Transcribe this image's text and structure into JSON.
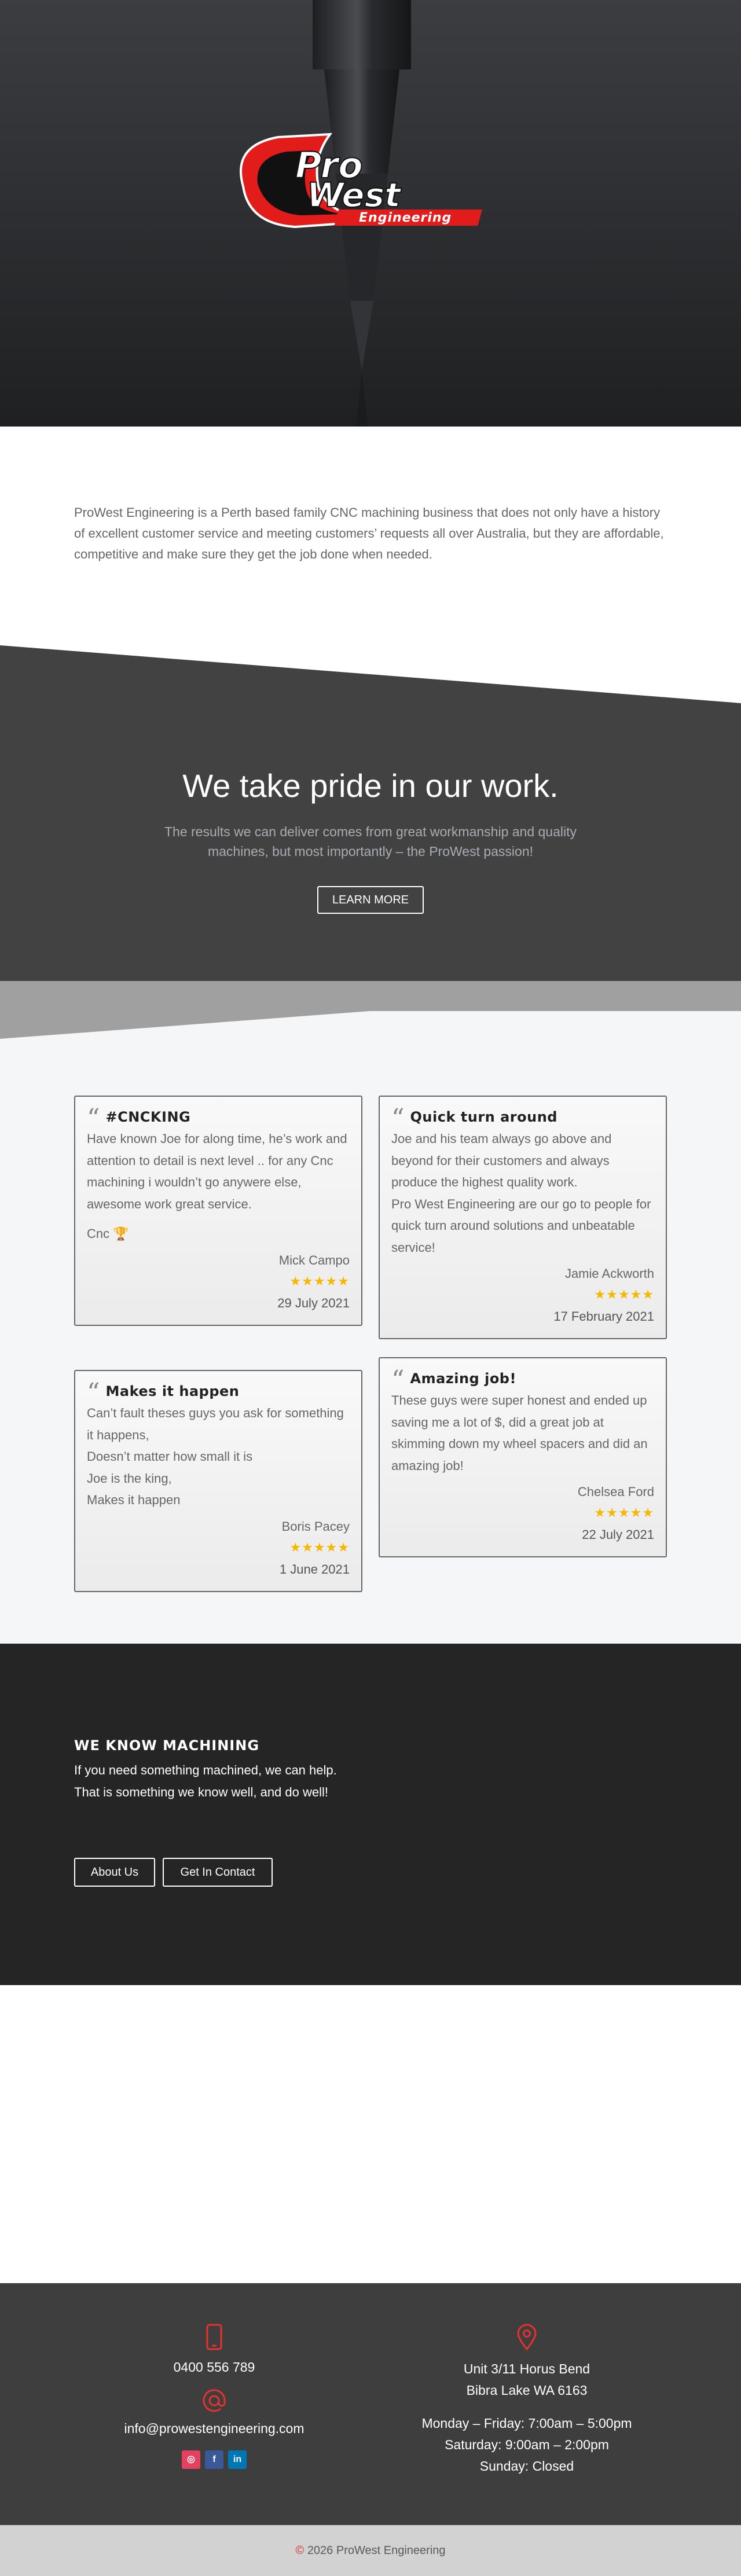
{
  "brand": {
    "logo_line1": "Pro",
    "logo_line2": "West",
    "logo_line3": "Engineering",
    "accent": "#e21b1b"
  },
  "intro": {
    "text": "ProWest Engineering is a Perth based family CNC machining business that does not only have a history of excellent customer service and meeting customers’ requests all over Australia, but they are affordable, competitive and make sure they get the job done when needed."
  },
  "pride": {
    "heading": "We take pride in our work.",
    "subtitle": "The results we can deliver comes from great workmanship and quality machines, but most importantly – the ProWest passion!",
    "button": "LEARN MORE"
  },
  "reviews": [
    {
      "title": "#CNCKING",
      "lines": [
        "Have known Joe for along time, he’s work and attention to detail is next level .. for any Cnc machining i wouldn’t go anywere else, awesome work great service."
      ],
      "extra": "Cnc 🏆",
      "author": "Mick Campo",
      "stars": "★★★★★",
      "date": "29 July 2021"
    },
    {
      "title": "Quick turn around",
      "lines": [
        "Joe and his team always go above and beyond for their customers and always produce the highest quality work.",
        "Pro West Engineering are our go to people for quick turn around solutions and unbeatable service!"
      ],
      "author": "Jamie Ackworth",
      "stars": "★★★★★",
      "date": "17 February 2021"
    },
    {
      "title": "Makes it happen",
      "lines": [
        "Can’t fault theses guys you ask for something it happens,",
        "Doesn’t matter how small it is",
        "Joe is the king,",
        "Makes it happen"
      ],
      "author": "Boris Pacey",
      "stars": "★★★★★",
      "date": "1 June 2021"
    },
    {
      "title": "Amazing job!",
      "lines": [
        "These guys were super honest and ended up saving me a lot of $, did a great job at skimming down my wheel spacers and did an amazing job!"
      ],
      "author": "Chelsea Ford",
      "stars": "★★★★★",
      "date": "22 July 2021"
    }
  ],
  "machining": {
    "heading": "WE KNOW MACHINING",
    "line1": "If you need something machined, we can help.",
    "line2": "That is something we know well, and do well!",
    "btn_about": "About Us",
    "btn_contact": "Get In Contact"
  },
  "footer": {
    "phone": "0400 556 789",
    "email": "info@prowestengineering.com",
    "address1": "Unit 3/11 Horus Bend",
    "address2": "Bibra Lake WA 6163",
    "hours1": "Monday – Friday: 7:00am – 5:00pm",
    "hours2": "Saturday: 9:00am – 2:00pm",
    "hours3": "Sunday: Closed",
    "icons": [
      "phone-icon",
      "at-icon",
      "location-pin-icon",
      "instagram-icon",
      "facebook-icon",
      "linkedin-icon"
    ],
    "social": {
      "instagram": "◎",
      "facebook": "f",
      "linkedin": "in"
    },
    "copyright": "2026 ProWest Engineering"
  }
}
